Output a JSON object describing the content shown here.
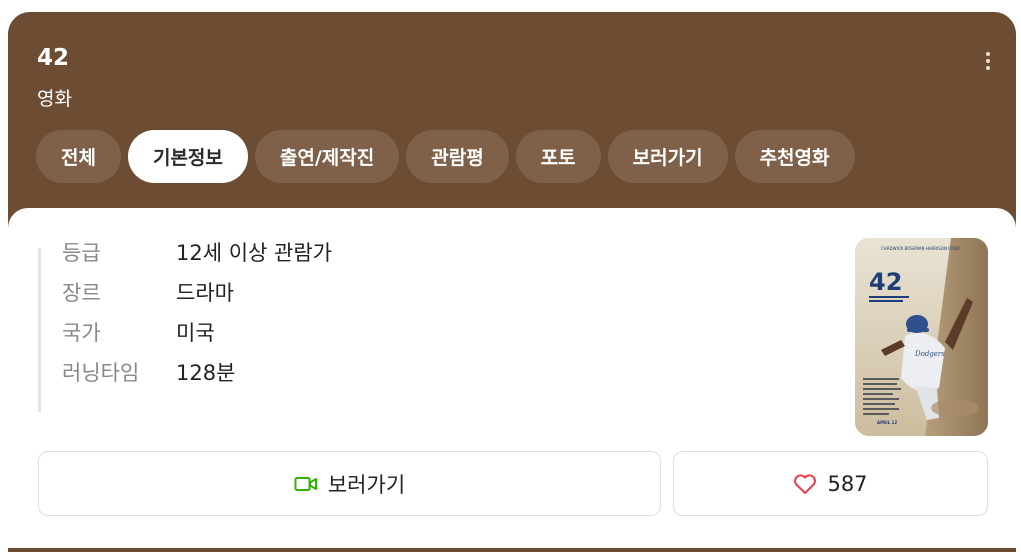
{
  "header": {
    "title": "42",
    "subtitle": "영화"
  },
  "tabs": [
    {
      "label": "전체",
      "active": false
    },
    {
      "label": "기본정보",
      "active": true
    },
    {
      "label": "출연/제작진",
      "active": false
    },
    {
      "label": "관람평",
      "active": false
    },
    {
      "label": "포토",
      "active": false
    },
    {
      "label": "보러가기",
      "active": false
    },
    {
      "label": "추천영화",
      "active": false
    }
  ],
  "info": [
    {
      "label": "등급",
      "value": "12세 이상 관람가"
    },
    {
      "label": "장르",
      "value": "드라마"
    },
    {
      "label": "국가",
      "value": "미국"
    },
    {
      "label": "러닝타임",
      "value": "128분"
    }
  ],
  "poster": {
    "title_text": "42",
    "cast_text": "CHADWICK BOSEMAN   HARRISON FORD",
    "release_text": "APRIL 12"
  },
  "actions": {
    "watch_label": "보러가기",
    "like_count": "587"
  },
  "colors": {
    "header_bg": "#6c4d33",
    "tab_bg": "#7f614a",
    "watch_icon": "#2db400",
    "heart_icon": "#e8414b"
  }
}
